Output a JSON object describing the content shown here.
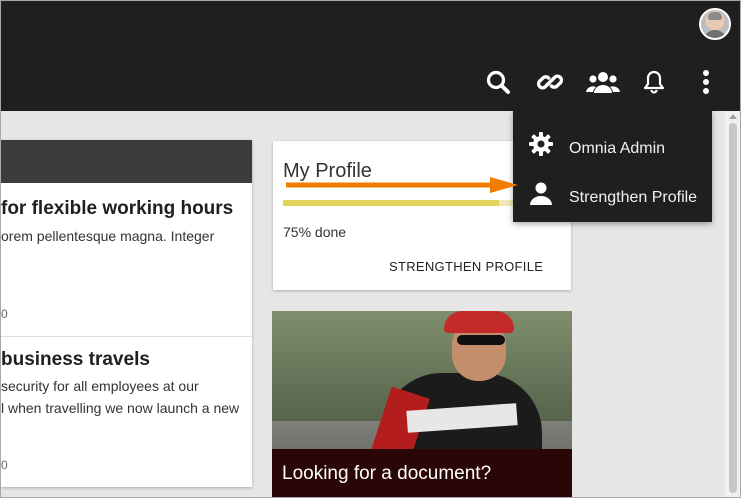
{
  "header": {
    "avatar_alt": "User avatar",
    "icons": [
      "search-icon",
      "link-icon",
      "people-icon",
      "bell-icon",
      "more-vertical-icon"
    ]
  },
  "news": [
    {
      "title": "for flexible working hours",
      "excerpt": "orem pellentesque magna. Integer",
      "date": "0"
    },
    {
      "title": "business travels",
      "excerpt_line1": "security for all employees at our",
      "excerpt_line2": "l when travelling we now launch a new",
      "date": "0"
    }
  ],
  "profile_card": {
    "title": "My Profile",
    "progress_percent": 75,
    "progress_text": "75% done",
    "button_label": "STRENGTHEN PROFILE"
  },
  "photo_card": {
    "caption": "Looking for a document?"
  },
  "menu": {
    "items": [
      {
        "label": "Omnia Admin",
        "icon": "gear-icon"
      },
      {
        "label": "Strengthen Profile",
        "icon": "person-icon"
      }
    ]
  },
  "colors": {
    "topbar": "#1f1f1f",
    "progress_fill": "#e3d55a",
    "arrow": "#f07d00"
  }
}
